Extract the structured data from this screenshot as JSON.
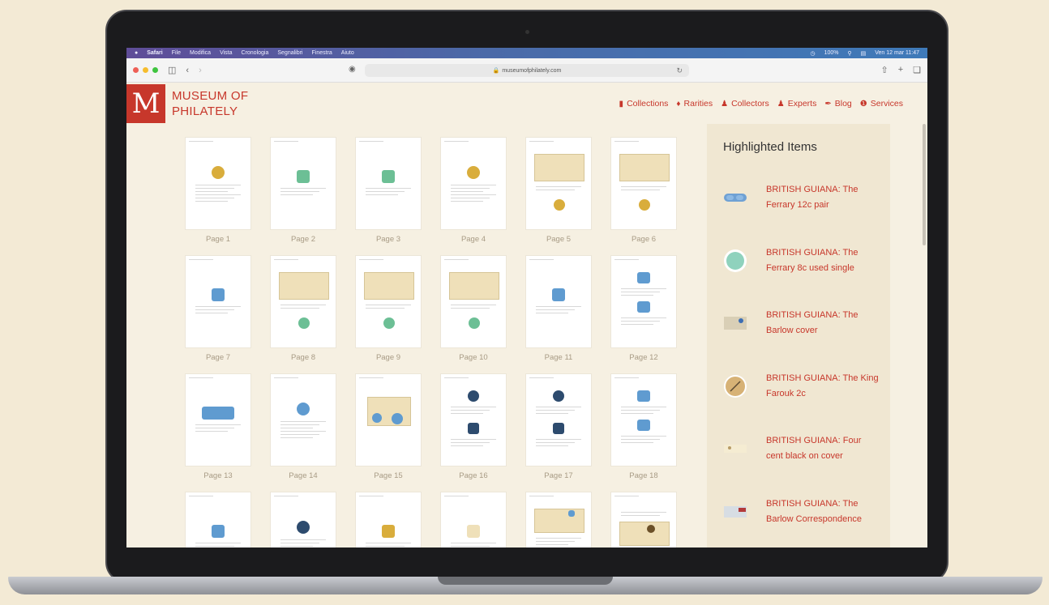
{
  "menubar": {
    "left": [
      "Safari",
      "File",
      "Modifica",
      "Vista",
      "Cronologia",
      "Segnalibri",
      "Finestra",
      "Aiuto"
    ],
    "battery": "100%",
    "datetime": "Ven 12 mar 11:47"
  },
  "browser": {
    "url": "museumofphilately.com"
  },
  "site": {
    "logo_letter": "M",
    "logo_line1": "MUSEUM OF",
    "logo_line2": "PHILATELY",
    "nav": [
      {
        "label": "Collections",
        "icon": "book-icon"
      },
      {
        "label": "Rarities",
        "icon": "gem-icon"
      },
      {
        "label": "Collectors",
        "icon": "person-icon"
      },
      {
        "label": "Experts",
        "icon": "expert-icon"
      },
      {
        "label": "Blog",
        "icon": "pen-icon"
      },
      {
        "label": "Services",
        "icon": "info-icon"
      }
    ]
  },
  "pages": [
    "Page 1",
    "Page 2",
    "Page 3",
    "Page 4",
    "Page 5",
    "Page 6",
    "Page 7",
    "Page 8",
    "Page 9",
    "Page 10",
    "Page 11",
    "Page 12",
    "Page 13",
    "Page 14",
    "Page 15",
    "Page 16",
    "Page 17",
    "Page 18"
  ],
  "sidebar": {
    "title": "Highlighted Items",
    "items": [
      {
        "title": "BRITISH GUIANA: The Ferrary 12c pair"
      },
      {
        "title": "BRITISH GUIANA: The Ferrary 8c used single"
      },
      {
        "title": "BRITISH GUIANA: The Barlow cover"
      },
      {
        "title": "BRITISH GUIANA: The King Farouk 2c"
      },
      {
        "title": "BRITISH GUIANA: Four cent black on cover"
      },
      {
        "title": "BRITISH GUIANA: The Barlow Correspondence"
      }
    ]
  },
  "colors": {
    "accent": "#c7372b",
    "background": "#f6f0e2"
  }
}
